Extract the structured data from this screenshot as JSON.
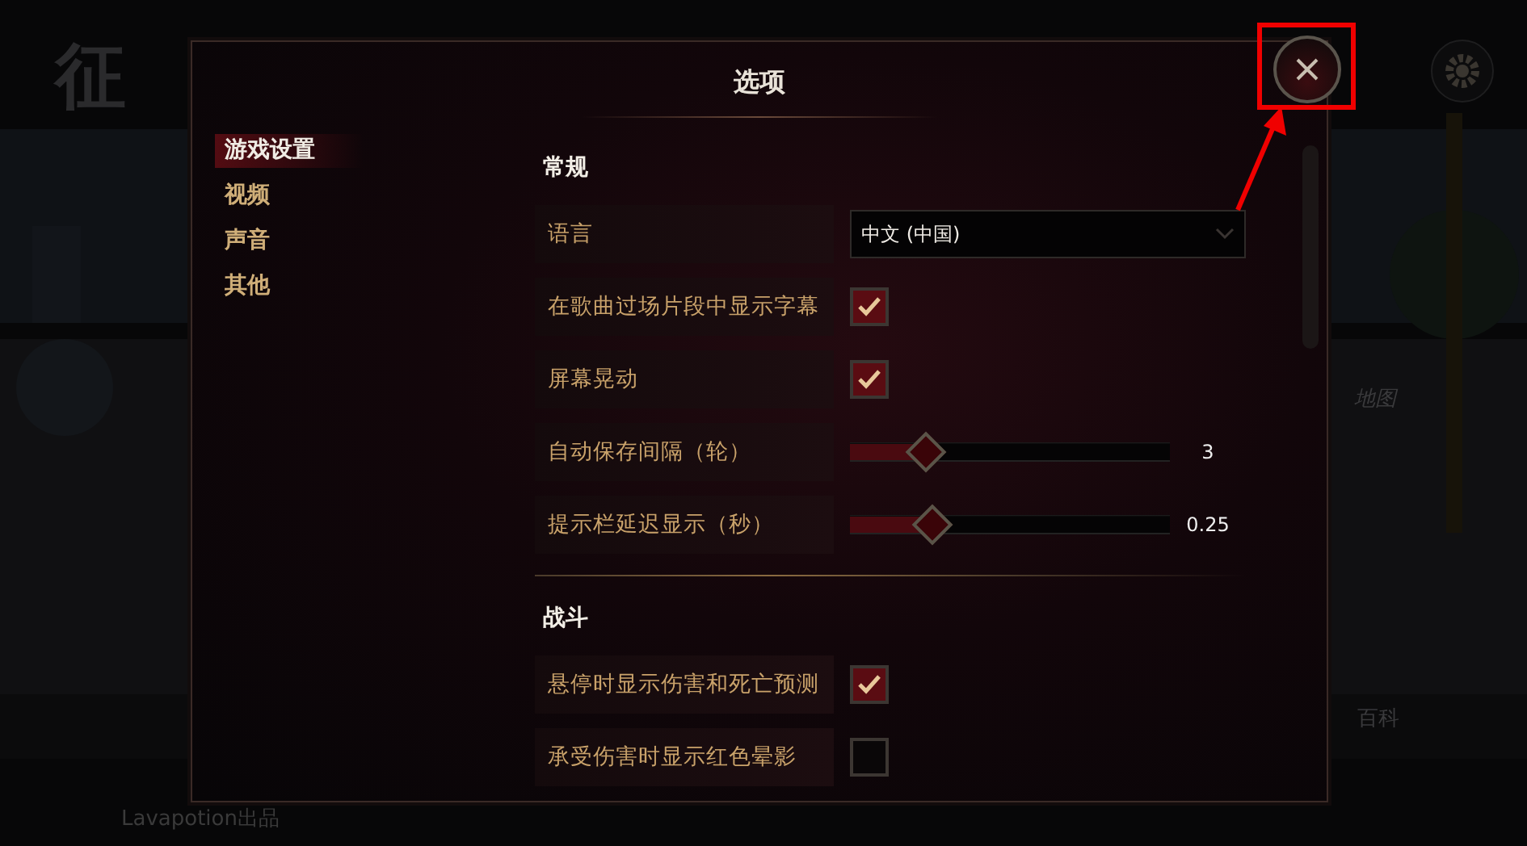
{
  "background": {
    "logo": "征",
    "labels": [
      {
        "text": "地图"
      },
      {
        "text": "百科"
      }
    ],
    "credit": "Lavapotion出品"
  },
  "dialog": {
    "title": "选项",
    "nav": [
      {
        "label": "游戏设置",
        "selected": true
      },
      {
        "label": "视频",
        "selected": false
      },
      {
        "label": "声音",
        "selected": false
      },
      {
        "label": "其他",
        "selected": false
      }
    ],
    "sections": [
      {
        "title": "常规",
        "rows": [
          {
            "kind": "dropdown",
            "label": "语言",
            "value": "中文 (中国)"
          },
          {
            "kind": "checkbox",
            "label": "在歌曲过场片段中显示字幕",
            "checked": true
          },
          {
            "kind": "checkbox",
            "label": "屏幕晃动",
            "checked": true
          },
          {
            "kind": "slider",
            "label": "自动保存间隔（轮）",
            "level": 0.23,
            "reading": "3"
          },
          {
            "kind": "slider",
            "label": "提示栏延迟显示（秒）",
            "level": 0.25,
            "reading": "0.25"
          }
        ]
      },
      {
        "title": "战斗",
        "rows": [
          {
            "kind": "checkbox",
            "label": "悬停时显示伤害和死亡预测",
            "checked": true
          },
          {
            "kind": "checkbox",
            "label": "承受伤害时显示红色晕影",
            "checked": false
          }
        ]
      }
    ]
  }
}
